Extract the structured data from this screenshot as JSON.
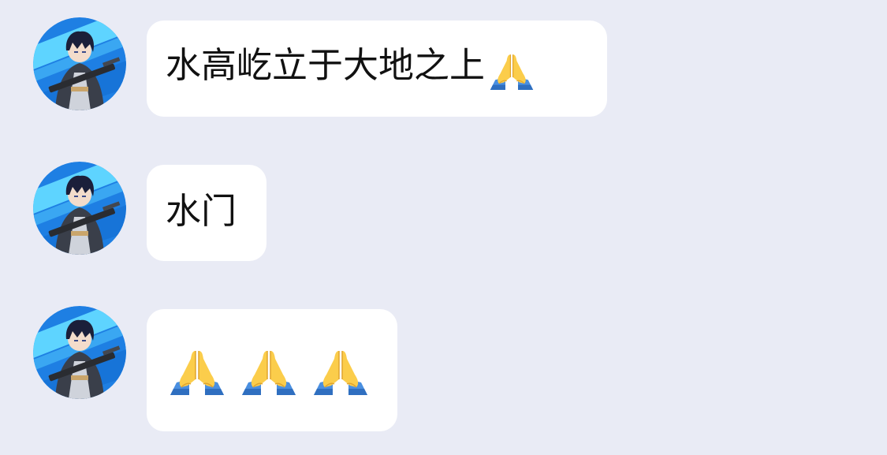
{
  "messages": [
    {
      "text": "水高屹立于大地之上",
      "emoji": "folded-hands",
      "emoji_count": 1
    },
    {
      "text": "水门",
      "emoji": "",
      "emoji_count": 0
    },
    {
      "text": "",
      "emoji": "folded-hands",
      "emoji_count": 3
    }
  ],
  "colors": {
    "background": "#e9ebf5",
    "bubble": "#ffffff",
    "text": "#111111",
    "avatar_background": "#1e7fe3",
    "avatar_stripe": "#5ed4ff",
    "emoji_hands": "#fbcd4b",
    "emoji_sleeve": "#4a8fe0"
  },
  "icons": {
    "avatar": "anime-character-avatar",
    "emoji": "folded-hands-icon"
  }
}
